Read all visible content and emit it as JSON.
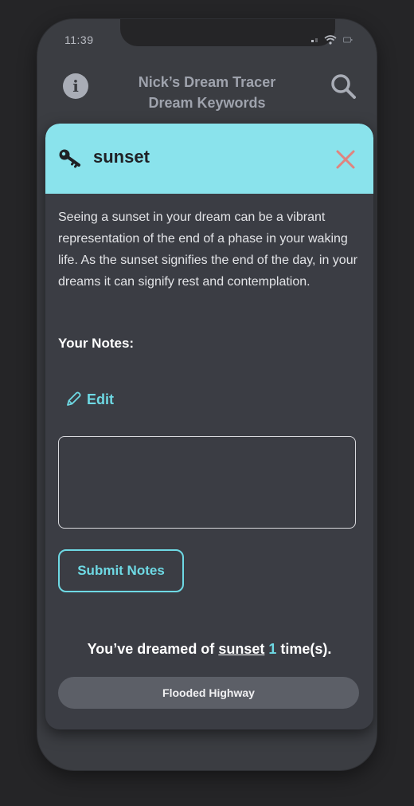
{
  "status_bar": {
    "time": "11:39"
  },
  "header": {
    "title_line1": "Nick’s Dream Tracer",
    "title_line2": "Dream Keywords"
  },
  "keyword_card": {
    "keyword": "sunset",
    "description": "Seeing a sunset in your dream can be a vibrant representation of the end of a phase in your waking life. As the sunset signifies the end of the day, in your dreams it can signify rest and contemplation.",
    "notes_label": "Your Notes:",
    "edit_label": "Edit",
    "notes_value": "",
    "submit_label": "Submit Notes",
    "count_prefix": "You’ve dreamed of ",
    "count_keyword": "sunset",
    "count_number": "1",
    "count_suffix": " time(s).",
    "dreams": [
      "Flooded Highway"
    ]
  },
  "icons": {
    "info": "info-icon",
    "search": "search-icon",
    "key": "key-icon",
    "close": "close-icon",
    "edit": "pencil-icon"
  },
  "colors": {
    "accent": "#6ed9e4",
    "header_band": "#8ae3ec",
    "close": "#e0847f",
    "background": "#3b3d42"
  }
}
